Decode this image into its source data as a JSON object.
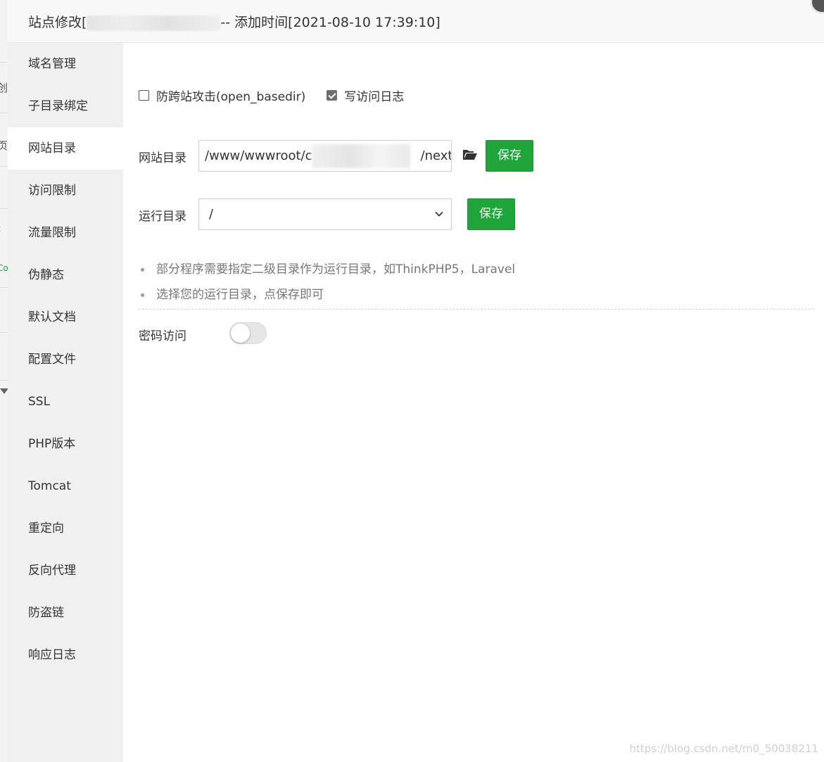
{
  "title": {
    "prefix": "站点修改[",
    "suffix": "-- 添加时间[2021-08-10 17:39:10]"
  },
  "sidebar": {
    "items": [
      {
        "label": "域名管理"
      },
      {
        "label": "子目录绑定"
      },
      {
        "label": "网站目录",
        "active": true
      },
      {
        "label": "访问限制"
      },
      {
        "label": "流量限制"
      },
      {
        "label": "伪静态"
      },
      {
        "label": "默认文档"
      },
      {
        "label": "配置文件"
      },
      {
        "label": "SSL"
      },
      {
        "label": "PHP版本"
      },
      {
        "label": "Tomcat"
      },
      {
        "label": "重定向"
      },
      {
        "label": "反向代理"
      },
      {
        "label": "防盗链"
      },
      {
        "label": "响应日志"
      }
    ]
  },
  "options": {
    "open_basedir_label": "防跨站攻击(open_basedir)",
    "open_basedir_checked": false,
    "access_log_label": "写访问日志",
    "access_log_checked": true
  },
  "site_dir": {
    "label": "网站目录",
    "value_start": "/www/wwwroot/c",
    "value_end": "/nextc",
    "save_label": "保存"
  },
  "run_dir": {
    "label": "运行目录",
    "selected": "/",
    "save_label": "保存"
  },
  "tips": [
    "部分程序需要指定二级目录作为运行目录，如ThinkPHP5，Laravel",
    "选择您的运行目录，点保存即可"
  ],
  "password_access": {
    "label": "密码访问",
    "enabled": false
  },
  "watermark": "https://blog.csdn.net/m0_50038211",
  "background_glyphs": [
    "创",
    "页",
    "t",
    "Co"
  ],
  "colors": {
    "accent": "#20a53a",
    "sidebar_bg": "#f0f0f0",
    "title_bg": "#f8f8f8"
  }
}
